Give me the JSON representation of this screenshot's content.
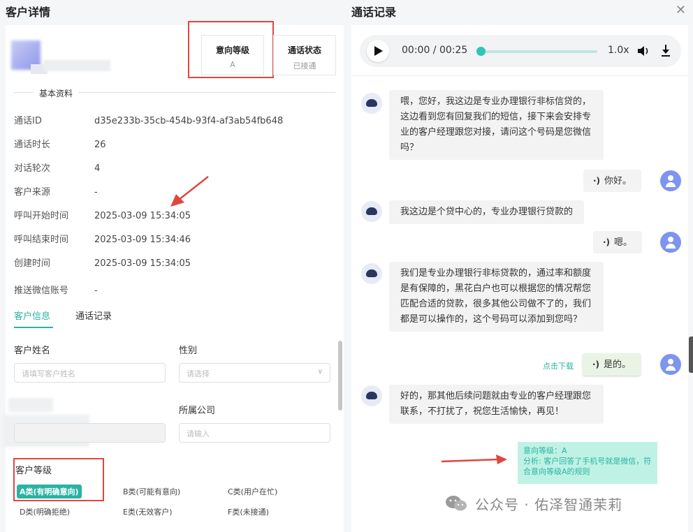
{
  "left": {
    "title": "客户详情",
    "stats": [
      {
        "title": "意向等级",
        "value": "A"
      },
      {
        "title": "通话状态",
        "value": "已接通"
      }
    ],
    "section_title": "基本资料",
    "fields": [
      {
        "key": "通话ID",
        "value": "d35e233b-35cb-454b-93f4-af3ab54fb648"
      },
      {
        "key": "通话时长",
        "value": "26"
      },
      {
        "key": "对话轮次",
        "value": "4"
      },
      {
        "key": "客户来源",
        "value": "-"
      },
      {
        "key": "呼叫开始时间",
        "value": "2025-03-09 15:34:05"
      },
      {
        "key": "呼叫结束时间",
        "value": "2025-03-09 15:34:46"
      },
      {
        "key": "创建时间",
        "value": "2025-03-09 15:34:05"
      },
      {
        "key": "推送微信账号",
        "value": "-"
      }
    ],
    "tabs": [
      "客户信息",
      "通话记录"
    ],
    "form": {
      "name_label": "客户姓名",
      "name_placeholder": "请填写客户姓名",
      "gender_label": "性别",
      "gender_placeholder": "请选择",
      "company_label": "所属公司",
      "company_placeholder": "请输入",
      "grade_label": "客户等级"
    },
    "grades": [
      "A类(有明确意向)",
      "B类(可能有意向)",
      "C类(用户在忙)",
      "D类(明确拒绝)",
      "E类(无效客户)",
      "F类(未接通)"
    ]
  },
  "right": {
    "title": "通话记录",
    "player": {
      "time": "00:00 / 00:25",
      "speed": "1.0x",
      "progress": 0.0
    },
    "messages": [
      {
        "role": "bot",
        "text": "喂，您好，我这边是专业办理银行非标信贷的，这边看到您有回复我们的短信，接下来会安排专业的客户经理跟您对接，请问这个号码是您微信吗？"
      },
      {
        "role": "user",
        "text": "你好。"
      },
      {
        "role": "bot",
        "text": "我这边是个贷中心的，专业办理银行贷款的"
      },
      {
        "role": "user",
        "text": "嗯。"
      },
      {
        "role": "bot",
        "text": "我们是专业办理银行非标贷款的，通过率和额度是有保障的，黑花白户也可以根据您的情况帮您匹配合适的贷款，很多其他公司做不了的，我们都是可以操作的，这个号码可以添加到您吗？"
      },
      {
        "role": "user",
        "text": "是的。"
      },
      {
        "role": "bot",
        "text": "好的，那其他后续问题就由专业的客户经理跟您联系，不打扰了，祝您生活愉快，再见！"
      }
    ],
    "download_link": "点击下载",
    "analysis_line1": "意向等级：A",
    "analysis_line2": "分析: 客户回答了手机号就是微信，符合意向等级A的规则"
  },
  "watermark": "公众号 · 佑泽智通茉莉",
  "colors": {
    "accent": "#2bb3a3",
    "highlight": "#e0463f",
    "user_avatar": "#7d95ee"
  }
}
